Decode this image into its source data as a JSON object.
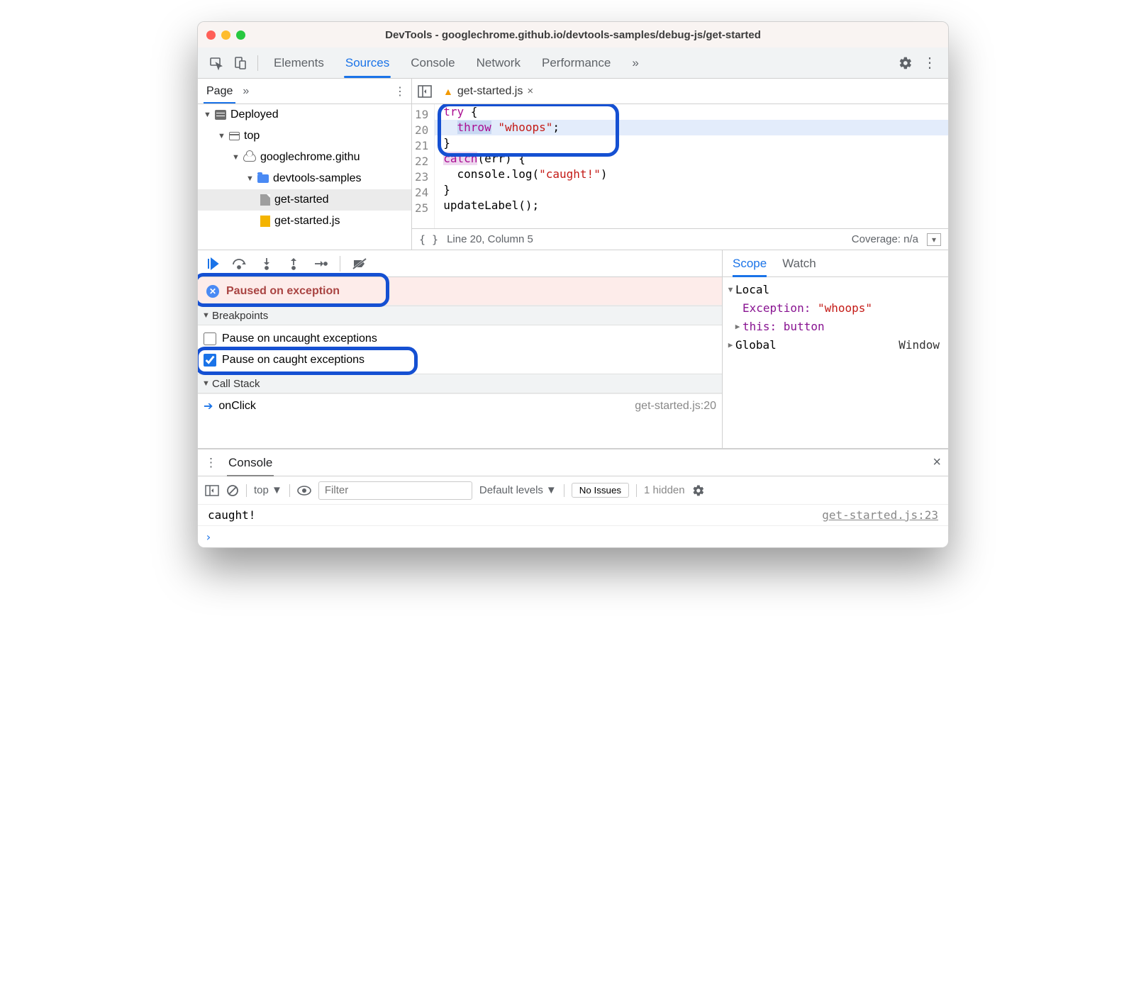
{
  "title": "DevTools - googlechrome.github.io/devtools-samples/debug-js/get-started",
  "tabs": {
    "elements": "Elements",
    "sources": "Sources",
    "console": "Console",
    "network": "Network",
    "performance": "Performance",
    "more": "»"
  },
  "sub": {
    "page": "Page",
    "more": "»",
    "file": "get-started.js"
  },
  "tree": {
    "deployed": "Deployed",
    "top": "top",
    "domain": "googlechrome.githu",
    "folder": "devtools-samples",
    "html": "get-started",
    "js": "get-started.js"
  },
  "code": {
    "lines": [
      "19",
      "20",
      "21",
      "22",
      "23",
      "24",
      "25"
    ],
    "l19a": "try",
    "l19b": " {",
    "l20a": "throw",
    "l20b": " ",
    "l20c": "\"whoops\"",
    "l20d": ";",
    "l21": "}",
    "l22a": "catch",
    "l22b": "(err) {",
    "l23a": "  console.log(",
    "l23b": "\"caught!\"",
    "l23c": ")",
    "l24": "}",
    "l25": "updateLabel();"
  },
  "codefoot": {
    "pos": "Line 20, Column 5",
    "cov": "Coverage: n/a"
  },
  "pause": {
    "msg": "Paused on exception"
  },
  "breakpoints": {
    "header": "Breakpoints",
    "uncaught": "Pause on uncaught exceptions",
    "caught": "Pause on caught exceptions"
  },
  "callstack": {
    "header": "Call Stack",
    "frame": "onClick",
    "loc": "get-started.js:20"
  },
  "scope": {
    "tab_scope": "Scope",
    "tab_watch": "Watch",
    "local": "Local",
    "exc_k": "Exception: ",
    "exc_v": "\"whoops\"",
    "this_k": "this: ",
    "this_v": "button",
    "global": "Global",
    "window": "Window"
  },
  "console": {
    "tab": "Console",
    "context": "top",
    "filter_ph": "Filter",
    "levels": "Default levels",
    "issues": "No Issues",
    "hidden": "1 hidden",
    "log": "caught!",
    "src": "get-started.js:23"
  }
}
